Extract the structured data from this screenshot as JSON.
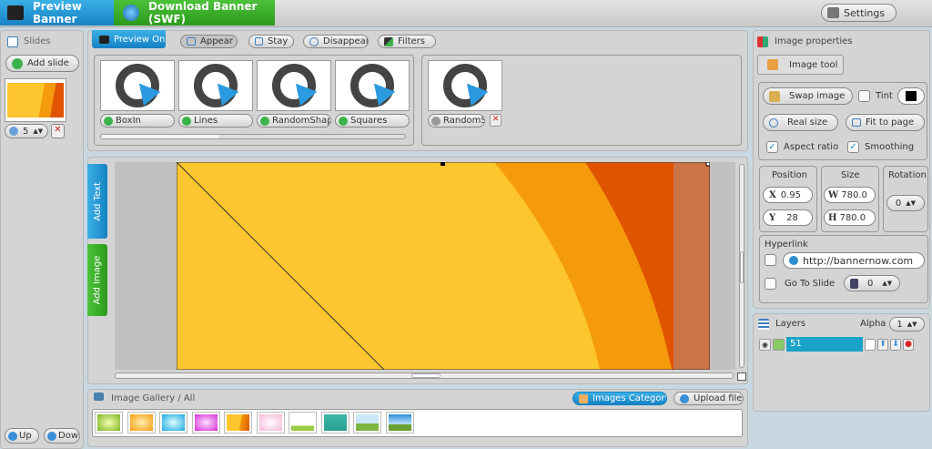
{
  "topbar": {
    "preview_banner": "Preview Banner",
    "download_banner": "Download Banner (SWF)",
    "settings": "Settings"
  },
  "slides": {
    "title": "Slides",
    "add_slide": "Add slide",
    "slide_duration": "5",
    "up": "Up",
    "down": "Down"
  },
  "toolbar": {
    "preview_on": "Preview On",
    "appear": "Appear",
    "stay": "Stay",
    "disappear": "Disappear",
    "filters": "Filters"
  },
  "transitions": [
    {
      "label": "BoxIn"
    },
    {
      "label": "Lines"
    },
    {
      "label": "RandomShapes"
    },
    {
      "label": "Squares"
    }
  ],
  "selected_transitions": [
    {
      "label": "RandomSl"
    }
  ],
  "canvas": {
    "add_text": "Add Text",
    "add_image": "Add Image",
    "colors": {
      "base": "#fdc52e",
      "orange": "#f59a0b",
      "dark": "#e05400",
      "salmon": "#cc7447"
    }
  },
  "gallery": {
    "title": "Image Gallery / All",
    "category": "Images Category",
    "upload": "Upload files",
    "images": [
      "green-burst",
      "orange-burst",
      "cyan-burst",
      "magenta-burst",
      "orange-curves",
      "pink-burst",
      "tree-white",
      "tree-teal",
      "landscape-1",
      "landscape-2"
    ]
  },
  "props": {
    "title": "Image properties",
    "image_tool": "Image tool",
    "swap_image": "Swap image",
    "tint": "Tint",
    "tint_color": "#000000",
    "real_size": "Real size",
    "fit_to_page": "Fit to page",
    "aspect_ratio": "Aspect ratio",
    "smoothing": "Smoothing",
    "position": "Position",
    "size": "Size",
    "rotation": "Rotation",
    "x_label": "X",
    "x": "0.95",
    "y_label": "Y",
    "y": "28",
    "w_label": "W",
    "w": "780.0",
    "h_label": "H",
    "h": "780.0",
    "rotation_value": "0",
    "hyperlink": "Hyperlink",
    "url": "http://bannernow.com",
    "go_to_slide": "Go To Slide",
    "slide_value": "0"
  },
  "layers": {
    "title": "Layers",
    "alpha": "Alpha",
    "alpha_value": "1",
    "items": [
      {
        "name": "51"
      }
    ]
  }
}
